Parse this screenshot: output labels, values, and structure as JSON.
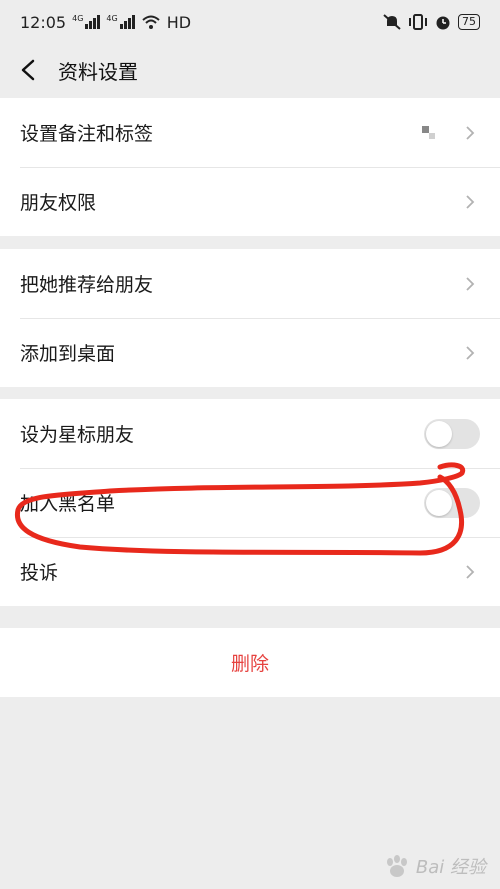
{
  "status_bar": {
    "time": "12:05",
    "net_tag_1": "4G",
    "net_tag_2": "4G",
    "hd": "HD",
    "battery": "75"
  },
  "header": {
    "title": "资料设置"
  },
  "groups": [
    {
      "rows": [
        {
          "label": "设置备注和标签",
          "accessory": "chevron"
        },
        {
          "label": "朋友权限",
          "accessory": "chevron"
        }
      ]
    },
    {
      "rows": [
        {
          "label": "把她推荐给朋友",
          "accessory": "chevron"
        },
        {
          "label": "添加到桌面",
          "accessory": "chevron"
        }
      ]
    },
    {
      "rows": [
        {
          "label": "设为星标朋友",
          "accessory": "toggle",
          "on": false
        },
        {
          "label": "加入黑名单",
          "accessory": "toggle",
          "on": false
        },
        {
          "label": "投诉",
          "accessory": "chevron"
        }
      ]
    }
  ],
  "delete_button": {
    "label": "删除"
  },
  "annotation": {
    "color": "#e8291c",
    "shape": "hand-drawn circle around blacklist row"
  },
  "watermark": {
    "text": "Bai 经验",
    "icon": "paw-icon"
  },
  "colors": {
    "background": "#ededed",
    "danger": "#e64340",
    "toggle_off": "#e3e3e3"
  }
}
